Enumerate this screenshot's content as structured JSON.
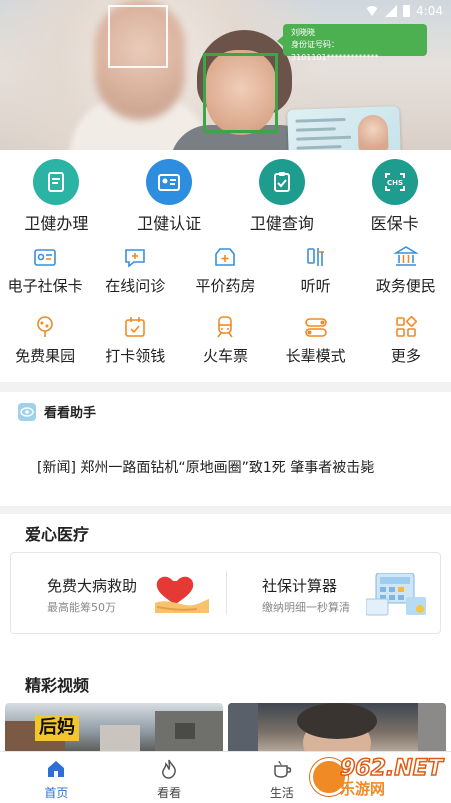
{
  "status_bar": {
    "time": "4:04"
  },
  "banner": {
    "bubble_name": "刘晓晓",
    "bubble_id": "身份证号码：3101101*************"
  },
  "top_services": [
    {
      "label": "卫健办理",
      "icon": "edit-document-icon",
      "color": "#2bb3a3"
    },
    {
      "label": "卫健认证",
      "icon": "id-card-icon",
      "color": "#2d8ee0"
    },
    {
      "label": "卫健查询",
      "icon": "query-clipboard-icon",
      "color": "#1e9c8e"
    },
    {
      "label": "医保卡",
      "icon": "chs-icon",
      "color": "#1e9c8e"
    }
  ],
  "grid_row1": [
    {
      "label": "电子社保卡",
      "icon": "social-security-card-icon"
    },
    {
      "label": "在线问诊",
      "icon": "online-consultation-icon"
    },
    {
      "label": "平价药房",
      "icon": "pharmacy-icon"
    },
    {
      "label": "听听",
      "icon": "listen-icon"
    },
    {
      "label": "政务便民",
      "icon": "government-building-icon"
    }
  ],
  "grid_row2": [
    {
      "label": "免费果园",
      "icon": "orchard-tree-icon"
    },
    {
      "label": "打卡领钱",
      "icon": "calendar-checkin-icon"
    },
    {
      "label": "火车票",
      "icon": "train-icon"
    },
    {
      "label": "长辈模式",
      "icon": "toggle-elder-mode-icon"
    },
    {
      "label": "更多",
      "icon": "more-grid-icon"
    }
  ],
  "colors": {
    "accent_orange": "#f08a24",
    "accent_blue": "#2f6fd6",
    "brand_green": "#4caf50"
  },
  "assistant": {
    "title": "看看助手",
    "news": "[新闻]  郑州一路面钻机“原地画圈”致1死 肇事者被击毙"
  },
  "care": {
    "section_title": "爱心医疗",
    "left_title": "免费大病救助",
    "left_sub": "最高能筹50万",
    "right_title": "社保计算器",
    "right_sub": "缴纳明细一秒算清"
  },
  "videos": {
    "section_title": "精彩视频",
    "video1_caption": "后妈"
  },
  "bottom_nav": [
    {
      "label": "首页",
      "icon": "home-icon",
      "active": true
    },
    {
      "label": "看看",
      "icon": "flame-icon",
      "active": false
    },
    {
      "label": "生活",
      "icon": "cup-icon",
      "active": false
    },
    {
      "label": "",
      "icon": "profile-icon",
      "active": false
    }
  ],
  "watermark": {
    "number": "962.NET",
    "text": "乐游网"
  }
}
